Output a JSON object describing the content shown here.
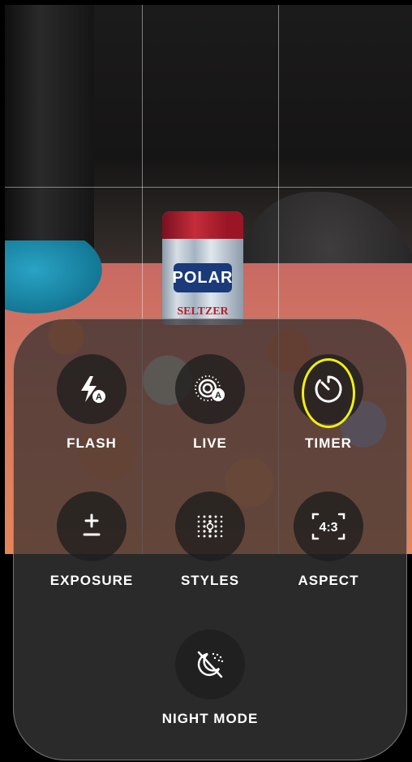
{
  "viewfinder": {
    "can_brand": "POLAR",
    "can_subtitle": "SELTZER"
  },
  "controls": {
    "flash": {
      "label": "FLASH",
      "icon": "flash-auto-icon",
      "badge": "A"
    },
    "live": {
      "label": "LIVE",
      "icon": "live-photo-auto-icon",
      "badge": "A"
    },
    "timer": {
      "label": "TIMER",
      "icon": "timer-icon"
    },
    "exposure": {
      "label": "EXPOSURE",
      "icon": "plus-minus-icon"
    },
    "styles": {
      "label": "STYLES",
      "icon": "photographic-styles-icon"
    },
    "aspect": {
      "label": "ASPECT",
      "icon": "aspect-ratio-icon",
      "value": "4:3"
    },
    "night_mode": {
      "label": "NIGHT MODE",
      "icon": "night-mode-off-icon"
    }
  },
  "colors": {
    "highlight": "#f1f00e",
    "panel": "#302e2e"
  }
}
